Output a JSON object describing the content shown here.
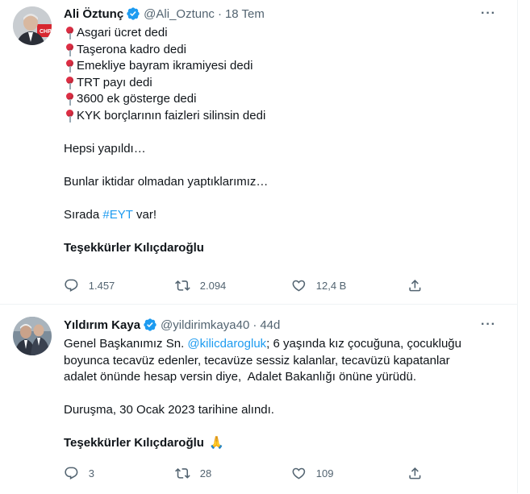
{
  "tweets": [
    {
      "name": "Ali Öztunç",
      "handle": "@Ali_Oztunc",
      "time": "18 Tem",
      "lines": [
        "Asgari ücret dedi",
        "Taşerona kadro dedi",
        "Emekliye bayram ikramiyesi dedi",
        "TRT payı dedi",
        "3600 ek gösterge dedi",
        "KYK borçlarının faizleri silinsin dedi"
      ],
      "para1": "Hepsi yapıldı…",
      "para2": "Bunlar iktidar olmadan yaptıklarımız…",
      "para3_prefix": "Sırada ",
      "para3_hashtag": "#EYT",
      "para3_suffix": " var!",
      "closing": "Teşekkürler Kılıçdaroğlu",
      "replies": "1.457",
      "retweets": "2.094",
      "likes": "12,4 B"
    },
    {
      "name": "Yıldırım Kaya",
      "handle": "@yildirimkaya40",
      "time": "44d",
      "line1_prefix": "Genel Başkanımız Sn. ",
      "line1_mention": "@kilicdarogluk",
      "line1_suffix": "; 6 yaşında kız çocuğuna, çocukluğu",
      "line2": "boyunca tecavüz edenler, tecavüze sessiz kalanlar, tecavüzü kapatanlar",
      "line3": "adalet önünde hesap versin diye,  Adalet Bakanlığı önüne yürüdü.",
      "para2": "Duruşma, 30 Ocak 2023 tarihine alındı.",
      "closing": "Teşekkürler Kılıçdaroğlu",
      "closing_emoji": "🙏",
      "replies": "3",
      "retweets": "28",
      "likes": "109"
    }
  ],
  "more_glyph": "···",
  "icons": [
    "verified-badge-icon",
    "reply-icon",
    "retweet-icon",
    "like-icon",
    "share-icon",
    "more-icon",
    "pushpin-icon"
  ],
  "colors": {
    "accent": "#1d9bf0",
    "muted": "#536471",
    "text": "#0f1419",
    "divider": "#eff3f4",
    "pin": "#dd2e44"
  }
}
